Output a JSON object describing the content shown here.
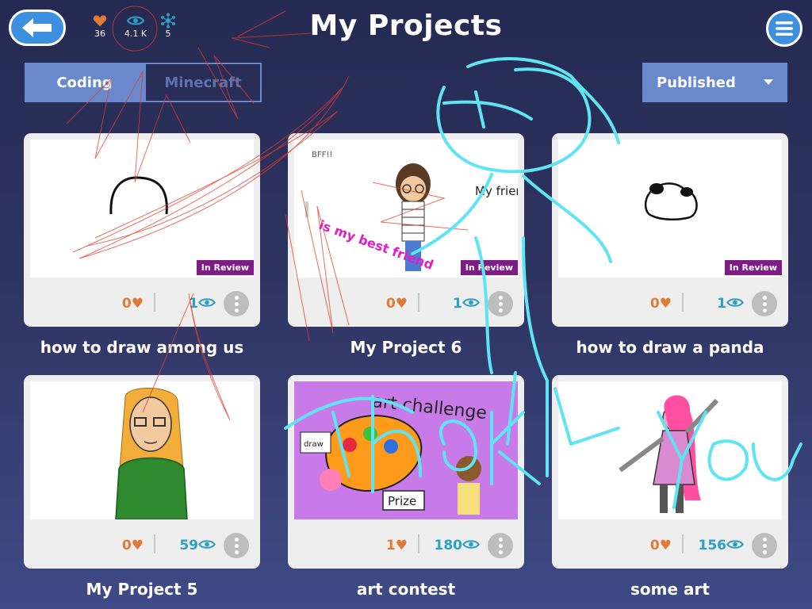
{
  "header": {
    "title": "My Projects",
    "stats": [
      {
        "icon": "heart-icon",
        "value": "36",
        "color": "#e07a36"
      },
      {
        "icon": "eye-icon",
        "value": "4.1 K",
        "color": "#2c9fc2"
      },
      {
        "icon": "remix-icon",
        "value": "5",
        "color": "#2c9fc2"
      }
    ]
  },
  "tabs": [
    {
      "label": "Coding",
      "active": true
    },
    {
      "label": "Minecraft",
      "active": false
    }
  ],
  "filter": {
    "selected": "Published"
  },
  "projects": [
    {
      "name": "how to draw among us",
      "likes": "0",
      "views": "1",
      "badge": "In Review"
    },
    {
      "name": "My Project 6",
      "likes": "0",
      "views": "1",
      "badge": "In Review"
    },
    {
      "name": "how to draw a panda",
      "likes": "0",
      "views": "1",
      "badge": "In Review"
    },
    {
      "name": "My Project 5",
      "likes": "0",
      "views": "59",
      "badge": ""
    },
    {
      "name": "art contest",
      "likes": "1",
      "views": "180",
      "badge": ""
    },
    {
      "name": "some art",
      "likes": "0",
      "views": "156",
      "badge": ""
    }
  ],
  "thumbnails": {
    "p6_notes": "BFF!!",
    "p6_label": "My friend (BFF)",
    "p6_pink": "is my best friend",
    "art_title": "art challenge",
    "art_prize": "Prize",
    "art_note": "draw"
  },
  "overlay": {
    "handwriting": "Thank you",
    "ink_color": "#5ee4f2"
  }
}
